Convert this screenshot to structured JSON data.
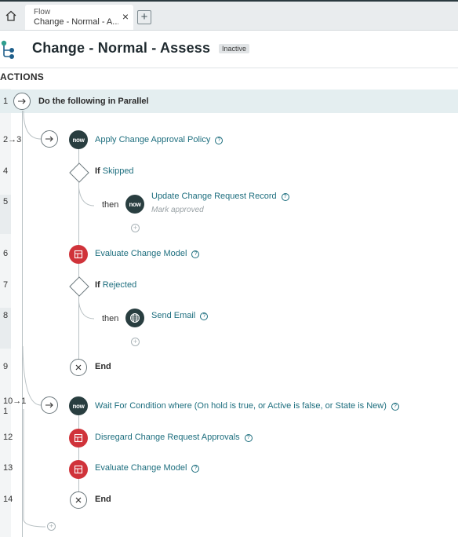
{
  "tab": {
    "title": "Flow",
    "subtitle": "Change - Normal - A..."
  },
  "header": {
    "title": "Change - Normal - Assess",
    "status": "Inactive"
  },
  "section": {
    "label": "ACTIONS"
  },
  "rows": {
    "r1": {
      "num": "1",
      "label": "Do the following in Parallel"
    },
    "r23": {
      "num": "2→3",
      "label": "Apply Change Approval Policy"
    },
    "r4": {
      "num": "4",
      "if": "If",
      "cond": "Skipped"
    },
    "r5": {
      "num": "5",
      "then": "then",
      "label": "Update Change Request Record",
      "sub": "Mark approved"
    },
    "r6": {
      "num": "6",
      "label": "Evaluate Change Model"
    },
    "r7": {
      "num": "7",
      "if": "If",
      "cond": "Rejected"
    },
    "r8": {
      "num": "8",
      "then": "then",
      "label": "Send Email"
    },
    "r9": {
      "num": "9",
      "label": "End"
    },
    "r10": {
      "num": "10→1",
      "num2": "1",
      "label": "Wait For Condition where (On hold is true, or Active is false, or State is New)"
    },
    "r12": {
      "num": "12",
      "label": "Disregard Change Request Approvals"
    },
    "r13": {
      "num": "13",
      "label": "Evaluate Change Model"
    },
    "r14": {
      "num": "14",
      "label": "End"
    }
  },
  "icons": {
    "now_logo_text": "now",
    "help_glyph": "?",
    "plus_glyph": "+",
    "close_glyph": "×"
  },
  "colors": {
    "link": "#1d6e7e",
    "now_bg": "#293e40",
    "red_action": "#d0333a",
    "parallel_bg": "#e4eef0"
  }
}
